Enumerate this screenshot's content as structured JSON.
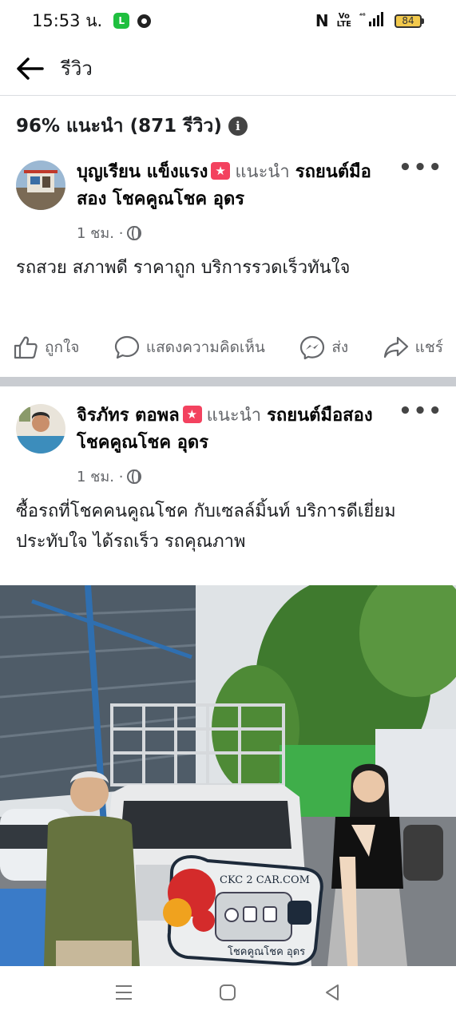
{
  "status": {
    "time": "15:53 น.",
    "network": "⁴ᴳ",
    "battery": "84"
  },
  "header": {
    "title": "รีวิว"
  },
  "summary": {
    "text": "96% แนะนำ (871 รีวิว)"
  },
  "reviews": [
    {
      "reviewer": "บุญเรียน แข็งแรง",
      "recommend_word": "แนะนำ",
      "page": "รถยนต์มือสอง โชคคูณโชค อุดร",
      "time": "1 ชม. ·",
      "text": "รถสวย สภาพดี ราคาถูก บริการรวดเร็วทันใจ"
    },
    {
      "reviewer": "จิรภัทร ตอพล",
      "recommend_word": "แนะนำ",
      "page": "รถยนต์มือสอง โชคคูณโชค อุดร",
      "time": "1 ชม. ·",
      "text": "ซื้อรถที่โชคคนคูณโชค กับเซลล์มิ้นท์ บริการดีเยี่ยม ประทับใจ ได้รถเร็ว รถคุณภาพ"
    }
  ],
  "actions": {
    "like": "ถูกใจ",
    "comment": "แสดงความคิดเห็น",
    "send": "ส่ง",
    "share": "แชร์"
  },
  "photo": {
    "plate_site": "CKC 2 CAR.COM",
    "plate_name": "โชคคูณโชค อุดร"
  },
  "colors": {
    "recommend_badge": "#f3425f",
    "divider": "#c9ccd1",
    "secondary_text": "#65676b"
  }
}
